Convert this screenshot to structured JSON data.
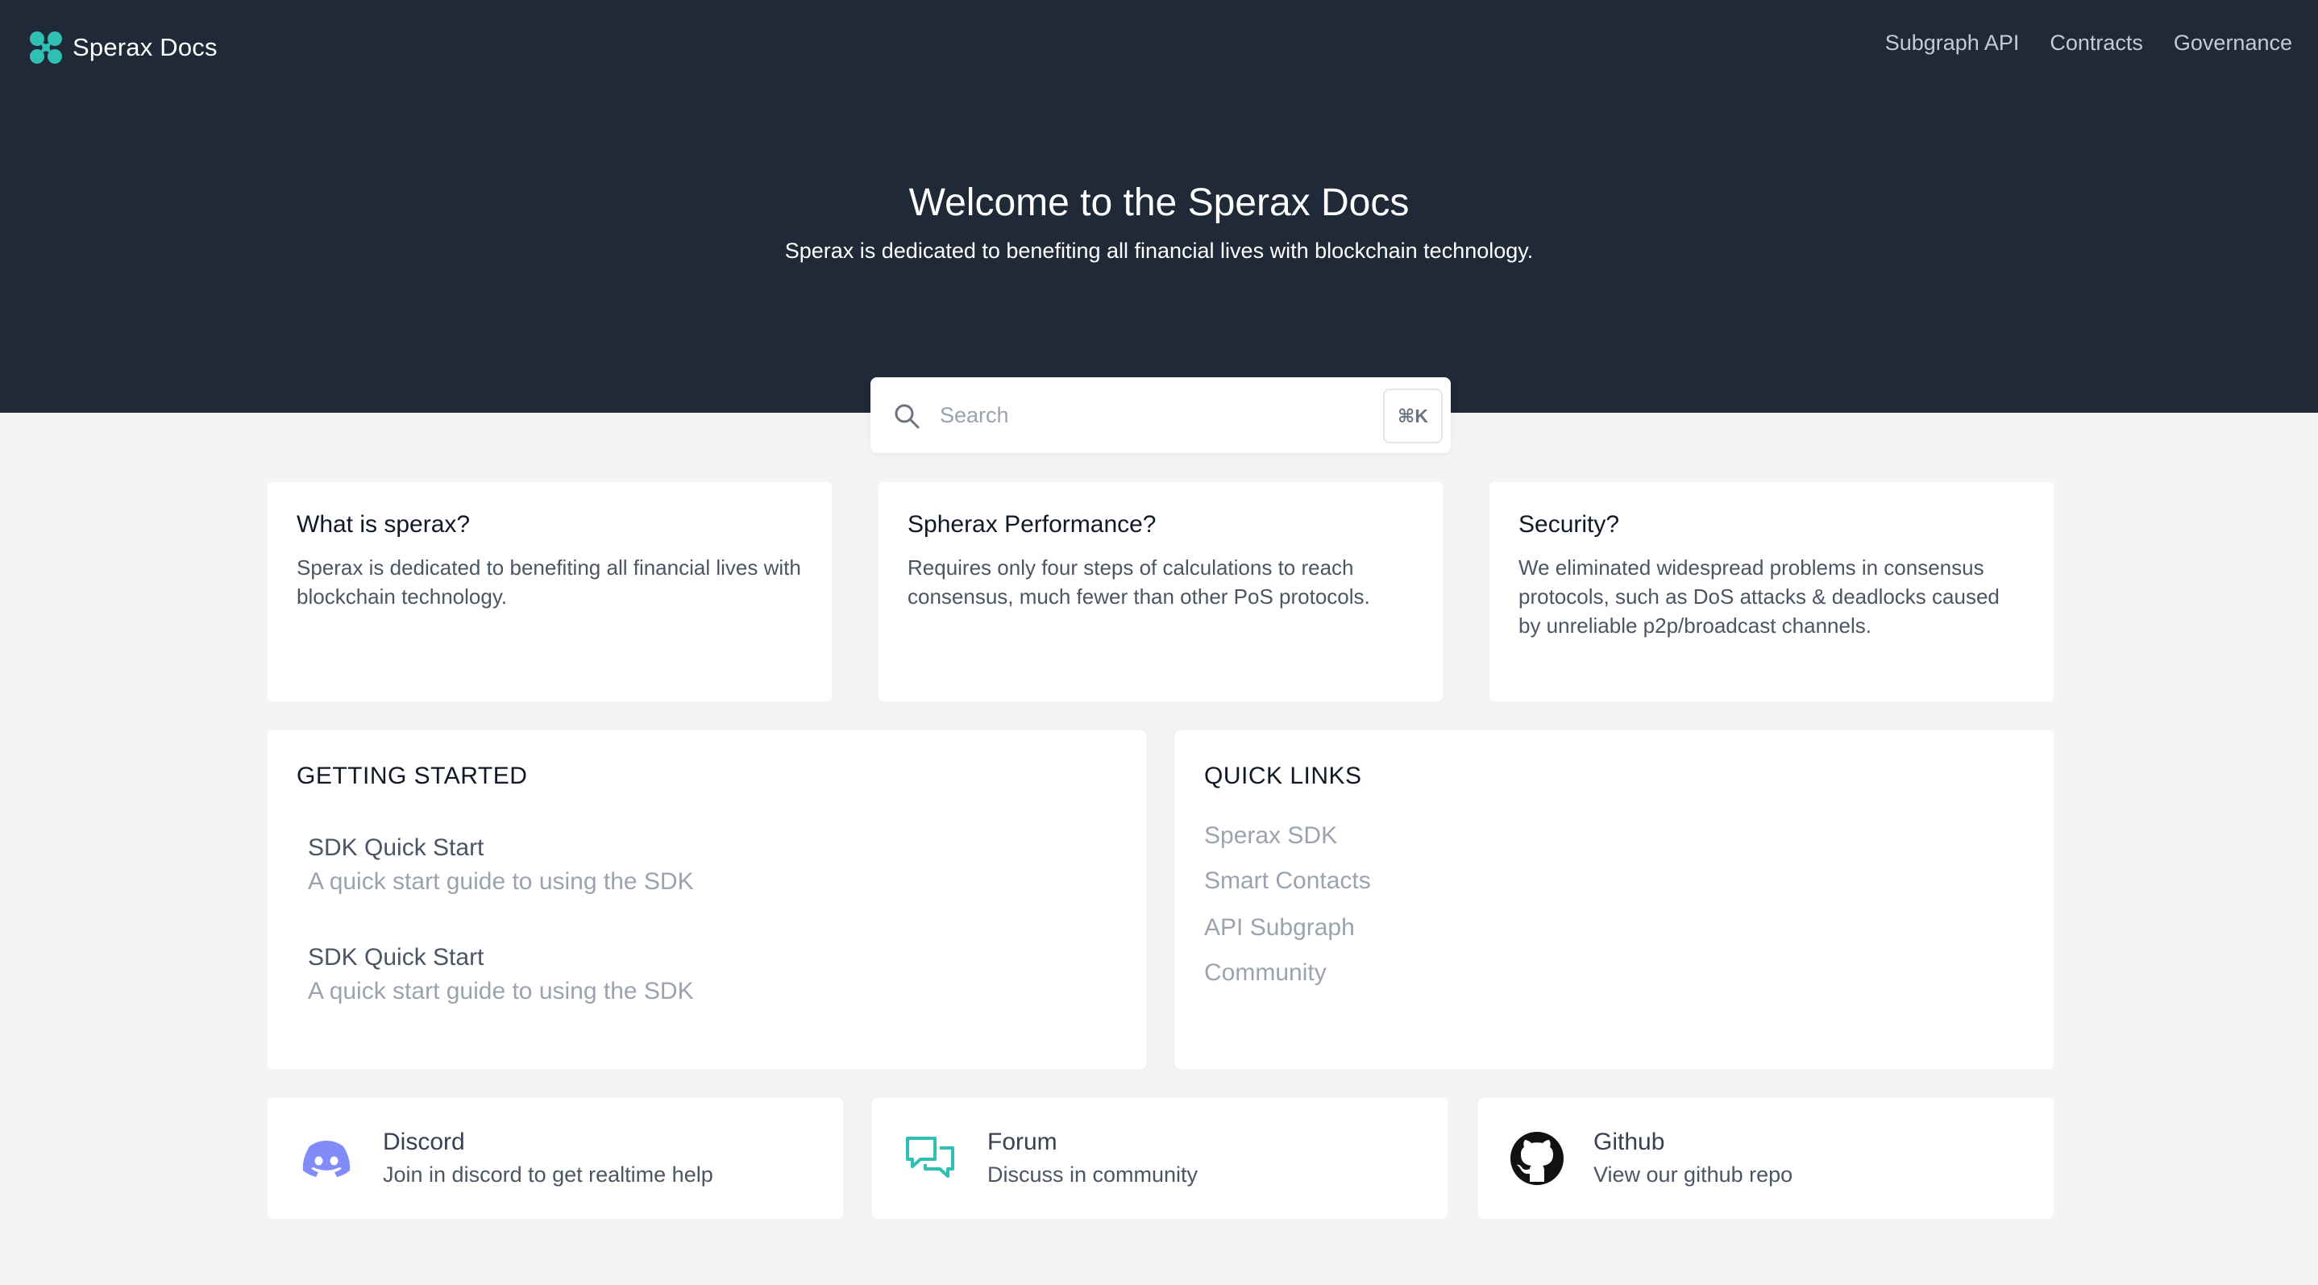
{
  "header": {
    "brand": "Sperax Docs",
    "nav": [
      {
        "label": "Subgraph API"
      },
      {
        "label": "Contracts"
      },
      {
        "label": "Governance"
      }
    ]
  },
  "hero": {
    "title": "Welcome to the Sperax Docs",
    "subtitle": "Sperax is dedicated to benefiting all financial lives with blockchain technology."
  },
  "search": {
    "placeholder": "Search",
    "shortcut": "⌘K"
  },
  "features": [
    {
      "title": "What is sperax?",
      "text": "Sperax is dedicated to benefiting all financial lives with blockchain technology."
    },
    {
      "title": "Spherax Performance?",
      "text": "Requires only four steps of calculations to reach consensus, much fewer than other PoS protocols."
    },
    {
      "title": "Security?",
      "text": "We eliminated widespread problems in consensus protocols, such as DoS attacks & deadlocks caused by unreliable p2p/broadcast channels."
    }
  ],
  "getting_started": {
    "title": "GETTING STARTED",
    "items": [
      {
        "title": "SDK Quick Start",
        "desc": "A quick start guide to using the SDK"
      },
      {
        "title": "SDK Quick Start",
        "desc": "A quick start guide to using the SDK"
      }
    ]
  },
  "quick_links": {
    "title": "QUICK LINKS",
    "links": [
      {
        "label": "Sperax SDK"
      },
      {
        "label": "Smart Contacts"
      },
      {
        "label": "API Subgraph"
      },
      {
        "label": "Community"
      }
    ]
  },
  "community": [
    {
      "title": "Discord",
      "desc": "Join in discord to get realtime help",
      "icon": "discord-icon",
      "color": "#818cf8"
    },
    {
      "title": "Forum",
      "desc": "Discuss in community",
      "icon": "forum-icon",
      "color": "#2fbfb3"
    },
    {
      "title": "Github",
      "desc": "View our github repo",
      "icon": "github-icon",
      "color": "#111111"
    }
  ],
  "colors": {
    "hero_bg": "#1f2937",
    "page_bg": "#f3f4f6",
    "brand_accent": "#2fbfb3"
  }
}
